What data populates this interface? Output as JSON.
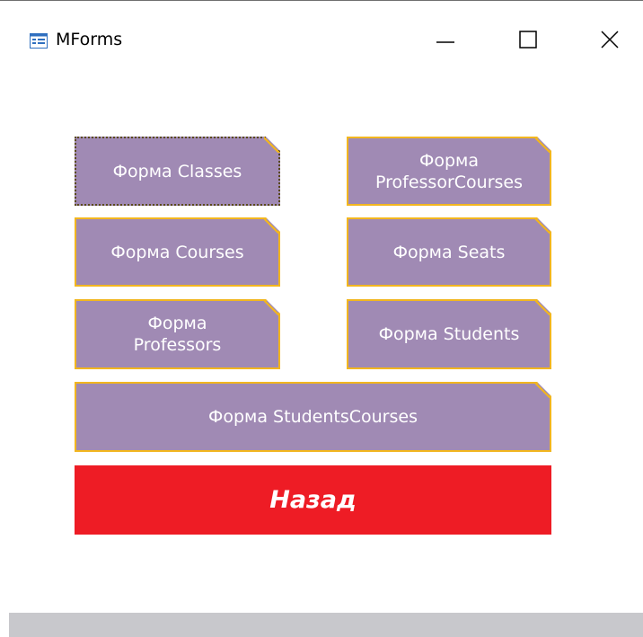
{
  "window": {
    "title": "MForms",
    "minimize_glyph": "—",
    "maximize_glyph": "☐",
    "close_glyph": "✕"
  },
  "buttons": {
    "classes": "Форма Classes",
    "professor_courses": "Форма ProfessorCourses",
    "courses": "Форма Courses",
    "seats": "Форма Seats",
    "professors": "Форма Professors",
    "students": "Форма Students",
    "students_courses": "Форма StudentsCourses",
    "back": "Назад"
  },
  "colors": {
    "form_button_fill": "#a08ab4",
    "form_button_border": "#f2b61f",
    "back_button_fill": "#ee1c25",
    "status_bar": "#c8c8cc"
  },
  "icons": {
    "app": "form-icon",
    "minimize": "minimize-icon",
    "maximize": "maximize-icon",
    "close": "close-icon"
  }
}
